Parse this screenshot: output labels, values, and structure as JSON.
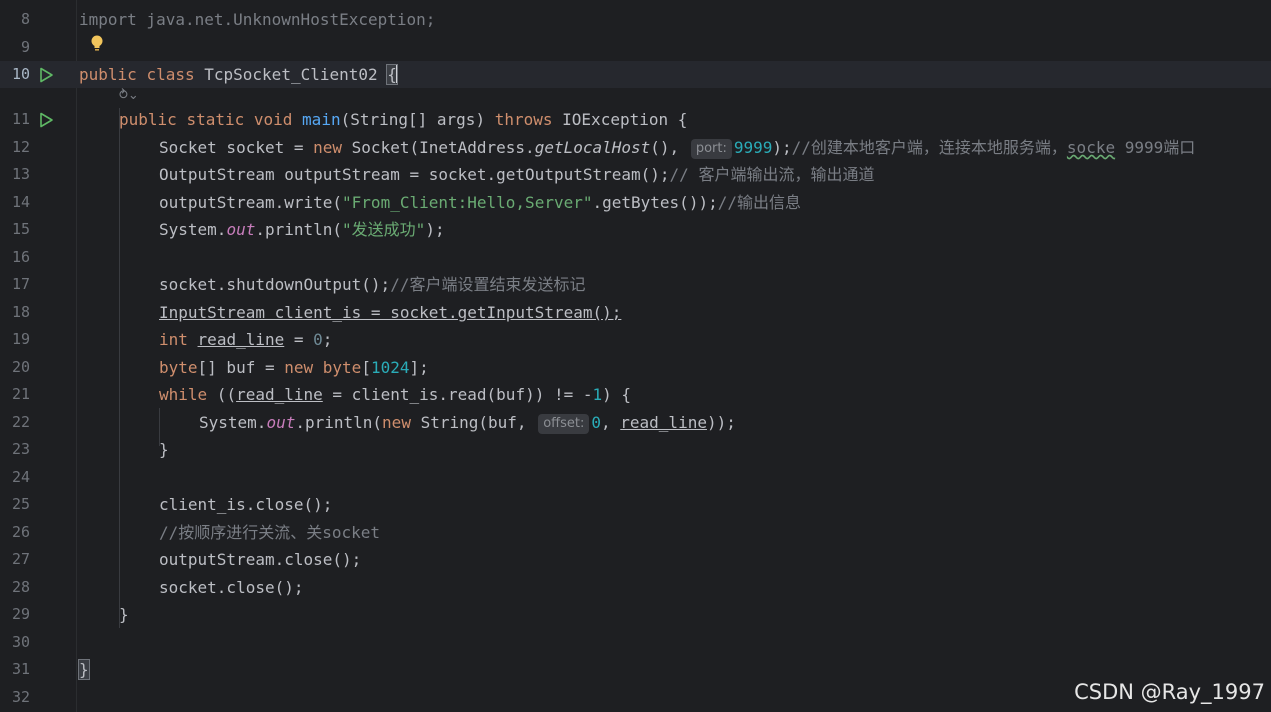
{
  "lines": {
    "l8": {
      "num": "8",
      "text": "import java.net.UnknownHostException;"
    },
    "l9": {
      "num": "9"
    },
    "l10": {
      "num": "10",
      "kw1": "public",
      "kw2": "class",
      "name": "TcpSocket_Client02",
      "brace": "{"
    },
    "l11": {
      "num": "11",
      "kw1": "public",
      "kw2": "static",
      "kw3": "void",
      "fn": "main",
      "params": "(String[] args)",
      "throws": "throws",
      "exc": "IOException {"
    },
    "l12": {
      "num": "12",
      "a": "Socket socket = ",
      "new": "new",
      "b": " Socket(InetAddress.",
      "m": "getLocalHost",
      "c": "(), ",
      "hint": "port:",
      "val": "9999",
      "d": ");",
      "cmt1": "//创建本地客户端，连接本地服务端，",
      "cmt2": "socke",
      "cmt3": " 9999端口"
    },
    "l13": {
      "num": "13",
      "a": "OutputStream outputStream = socket.getOutputStream();",
      "cmt": "// 客户端输出流，输出通道"
    },
    "l14": {
      "num": "14",
      "a": "outputStream.write(",
      "str": "\"From_Client:Hello,Server\"",
      "b": ".getBytes());",
      "cmt": "//输出信息"
    },
    "l15": {
      "num": "15",
      "a": "System.",
      "field": "out",
      "b": ".println(",
      "str": "\"发送成功\"",
      "c": ");"
    },
    "l16": {
      "num": "16"
    },
    "l17": {
      "num": "17",
      "a": "socket.shutdownOutput();",
      "cmt": "//客户端设置结束发送标记"
    },
    "l18": {
      "num": "18",
      "a": "InputStream client_is = socket.getInputStream();"
    },
    "l19": {
      "num": "19",
      "kw": "int",
      "v": "read_line",
      "a": " = ",
      "n": "0",
      "b": ";"
    },
    "l20": {
      "num": "20",
      "kw": "byte",
      "a": "[] buf = ",
      "new": "new",
      "kw2": "byte",
      "b": "[",
      "n": "1024",
      "c": "];"
    },
    "l21": {
      "num": "21",
      "kw": "while",
      "a": " ((",
      "v": "read_line",
      "b": " = client_is.read(buf)) != -",
      "n": "1",
      "c": ") {"
    },
    "l22": {
      "num": "22",
      "a": "System.",
      "field": "out",
      "b": ".println(",
      "new": "new",
      "c": " String(buf, ",
      "hint": "offset:",
      "n": "0",
      "d": ", ",
      "v": "read_line",
      "e": "));"
    },
    "l23": {
      "num": "23",
      "a": "}"
    },
    "l24": {
      "num": "24"
    },
    "l25": {
      "num": "25",
      "a": "client_is.close();"
    },
    "l26": {
      "num": "26",
      "cmt": "//按顺序进行关流、关socket"
    },
    "l27": {
      "num": "27",
      "a": "outputStream.close();"
    },
    "l28": {
      "num": "28",
      "a": "socket.close();"
    },
    "l29": {
      "num": "29",
      "a": "}"
    },
    "l30": {
      "num": "30"
    },
    "l31": {
      "num": "31",
      "a": "}"
    },
    "l32": {
      "num": "32"
    }
  },
  "codelens": "⥁⌄",
  "watermark": "CSDN @Ray_1997",
  "colors": {
    "background": "#1e1f22",
    "keyword": "#cf8e6d",
    "function": "#56a8f5",
    "number": "#2aacb8",
    "string": "#6aab73",
    "comment": "#7a7e85",
    "field": "#c77dbb",
    "run_icon": "#5fb865",
    "bulb": "#f2c55c"
  }
}
